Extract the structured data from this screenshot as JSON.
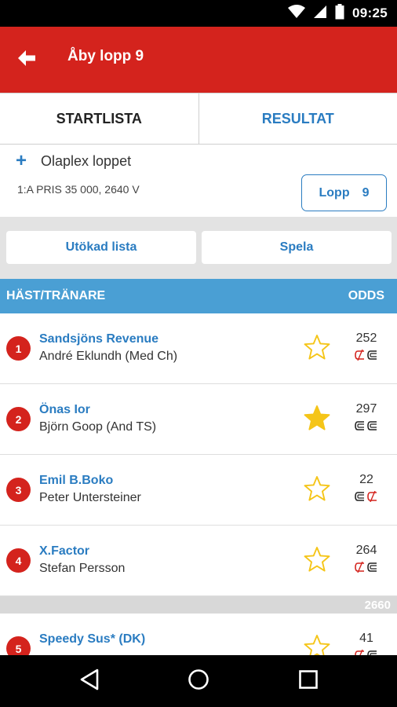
{
  "status_bar": {
    "time": "09:25",
    "icons": [
      "wifi-icon",
      "signal-icon",
      "battery-icon"
    ]
  },
  "header": {
    "title": "Åby lopp 9",
    "back_icon": "arrow-left-icon"
  },
  "tabs": [
    {
      "label": "STARTLISTA",
      "active": true
    },
    {
      "label": "RESULTAT",
      "active": false
    }
  ],
  "race": {
    "expand_symbol": "+",
    "name": "Olaplex loppet",
    "prize": "1:A PRIS 35 000, 2640 V",
    "lopp_label": "Lopp",
    "lopp_number": "9"
  },
  "actions": {
    "extended_list": "Utökad lista",
    "play": "Spela"
  },
  "table_header": {
    "left": "HÄST/TRÄNARE",
    "right": "ODDS"
  },
  "starters": [
    {
      "number": "1",
      "horse": "Sandsjöns Revenue",
      "trainer": "André Eklundh (Med Ch)",
      "favorite": false,
      "odds": "252",
      "shoes": [
        "off",
        "on"
      ]
    },
    {
      "number": "2",
      "horse": "Önas Ior",
      "trainer": "Björn Goop (And TS)",
      "favorite": true,
      "odds": "297",
      "shoes": [
        "on",
        "on"
      ]
    },
    {
      "number": "3",
      "horse": "Emil B.Boko",
      "trainer": "Peter Untersteiner",
      "favorite": false,
      "odds": "22",
      "shoes": [
        "on",
        "off"
      ]
    },
    {
      "number": "4",
      "horse": "X.Factor",
      "trainer": "Stefan Persson",
      "favorite": false,
      "odds": "264",
      "shoes": [
        "off",
        "on"
      ]
    }
  ],
  "distance_divider": "2660",
  "starters_2660": [
    {
      "number": "5",
      "horse": "Speedy Sus* (DK)",
      "trainer": "",
      "favorite": false,
      "odds": "41",
      "shoes": [
        "off",
        "on"
      ]
    }
  ],
  "colors": {
    "brand_red": "#d4231d",
    "link_blue": "#2a7cc1",
    "header_blue": "#4a9fd4",
    "star_gold": "#f5c518"
  },
  "nav_bar": {
    "icons": [
      "back-triangle-icon",
      "home-circle-icon",
      "recents-square-icon"
    ]
  }
}
